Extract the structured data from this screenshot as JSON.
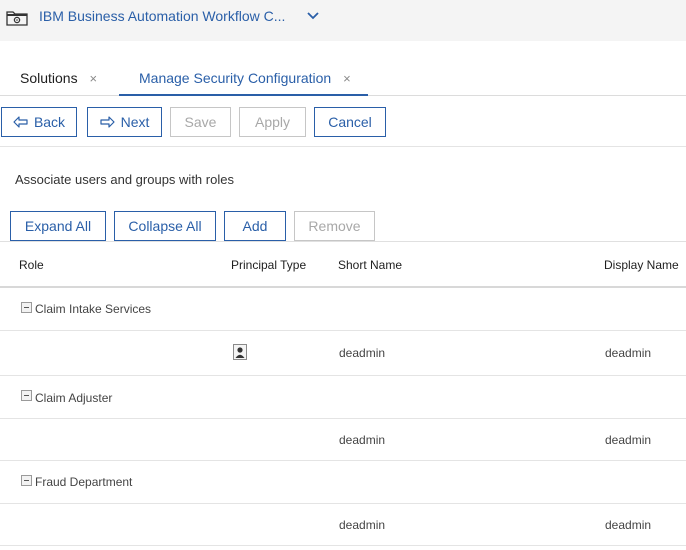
{
  "header": {
    "app_title": "IBM Business Automation Workflow C...",
    "folder_icon": "folder-gear-icon",
    "chevron_icon": "chevron-down-icon"
  },
  "tabs": [
    {
      "label": "Solutions",
      "close": "×",
      "active": false
    },
    {
      "label": "Manage Security Configuration",
      "close": "×",
      "active": true
    }
  ],
  "toolbar": {
    "back_label": "Back",
    "next_label": "Next",
    "save_label": "Save",
    "apply_label": "Apply",
    "cancel_label": "Cancel"
  },
  "description": "Associate users and groups with roles",
  "actions": {
    "expand_all_label": "Expand All",
    "collapse_all_label": "Collapse All",
    "add_label": "Add",
    "remove_label": "Remove"
  },
  "grid": {
    "columns": [
      "Role",
      "Principal Type",
      "Short Name",
      "Display Name"
    ],
    "groups": [
      {
        "role": "Claim Intake Services",
        "principal_icon": "user-icon",
        "short_name": "deadmin",
        "display_name": "deadmin"
      },
      {
        "role": "Claim Adjuster",
        "principal_icon": "",
        "short_name": "deadmin",
        "display_name": "deadmin"
      },
      {
        "role": "Fraud Department",
        "principal_icon": "",
        "short_name": "deadmin",
        "display_name": "deadmin"
      }
    ]
  },
  "colors": {
    "accent": "#2a5fa8",
    "disabled": "#a8a8a8",
    "header_bg": "#f4f4f4"
  }
}
